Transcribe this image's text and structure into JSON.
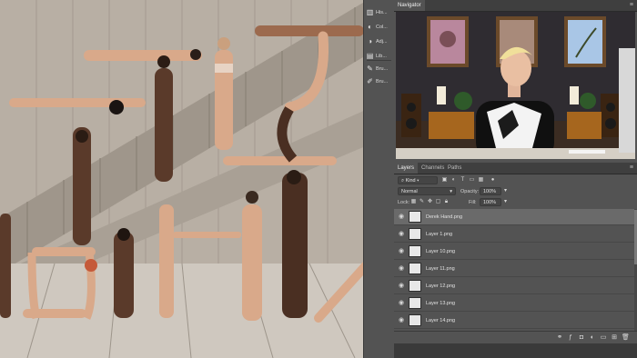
{
  "tool_panel": {
    "items": [
      {
        "icon": "histogram-icon",
        "label": "His..."
      },
      {
        "icon": "color-icon",
        "label": "Col..."
      },
      {
        "icon": "adjustments-icon",
        "label": "Adj..."
      },
      {
        "icon": "libraries-icon",
        "label": "Lib..."
      },
      {
        "icon": "brush-icon",
        "label": "Bru..."
      },
      {
        "icon": "brush-settings-icon",
        "label": "Bru..."
      }
    ]
  },
  "navigator": {
    "tab": "Navigator"
  },
  "layers_panel": {
    "tabs": [
      "Layers",
      "Channels",
      "Paths"
    ],
    "filter_kind": "Kind",
    "blend_mode": "Normal",
    "opacity_label": "Opacity:",
    "opacity_value": "100%",
    "lock_label": "Lock:",
    "fill_label": "Fill:",
    "fill_value": "100%",
    "layers": [
      {
        "name": "Derek Hand.png",
        "selected": true
      },
      {
        "name": "Layer 1.png",
        "selected": false
      },
      {
        "name": "Layer 10.png",
        "selected": false
      },
      {
        "name": "Layer 11.png",
        "selected": false
      },
      {
        "name": "Layer 12.png",
        "selected": false
      },
      {
        "name": "Layer 13.png",
        "selected": false
      },
      {
        "name": "Layer 14.png",
        "selected": false
      }
    ],
    "footer_icons": [
      "link-icon",
      "fx-icon",
      "mask-icon",
      "adjustment-layer-icon",
      "group-icon",
      "new-layer-icon",
      "trash-icon"
    ]
  },
  "colors": {
    "panel_bg": "#535353",
    "tab_bg": "#3f3f3f",
    "selected_row": "#6a6a6a",
    "canvas_wall": "#b5ada3"
  }
}
